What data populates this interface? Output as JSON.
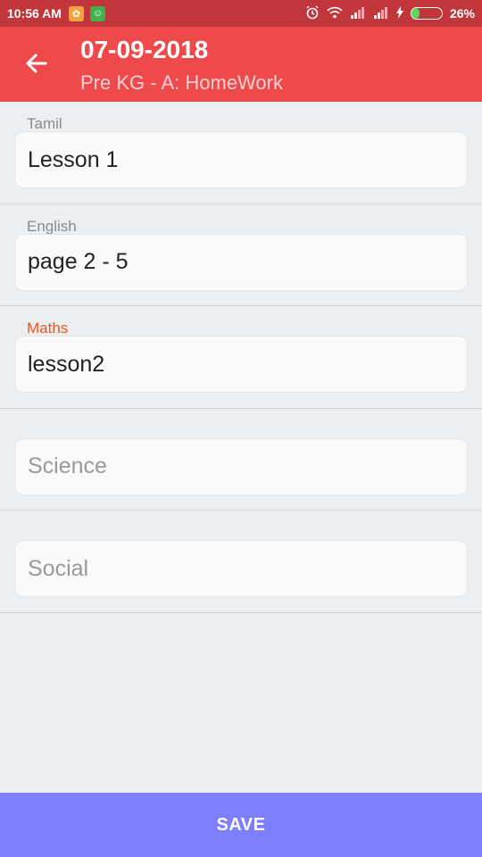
{
  "status_bar": {
    "time": "10:56 AM",
    "battery_percent": "26%",
    "battery_level": 0.26,
    "icons": [
      "app-notification-icon",
      "app-notification-icon",
      "alarm-icon",
      "wifi-icon",
      "signal-icon",
      "signal-icon",
      "charging-icon",
      "battery-icon"
    ]
  },
  "header": {
    "title": "07-09-2018",
    "subtitle": "Pre KG - A: HomeWork",
    "back_icon": "arrow-left-icon",
    "background_color": "#ef4a4b"
  },
  "subjects": [
    {
      "label": "Tamil",
      "value": "Lesson 1",
      "placeholder": ""
    },
    {
      "label": "English",
      "value": "page 2 - 5",
      "placeholder": ""
    },
    {
      "label": "Maths",
      "value": "lesson2",
      "placeholder": "",
      "focused": true
    },
    {
      "label": "",
      "value": "",
      "placeholder": "Science"
    },
    {
      "label": "",
      "value": "",
      "placeholder": "Social"
    }
  ],
  "footer": {
    "save_label": "SAVE",
    "background_color": "#7d7efb"
  },
  "colors": {
    "status_bar": "#c1363a",
    "focused_label": "#f35322"
  }
}
